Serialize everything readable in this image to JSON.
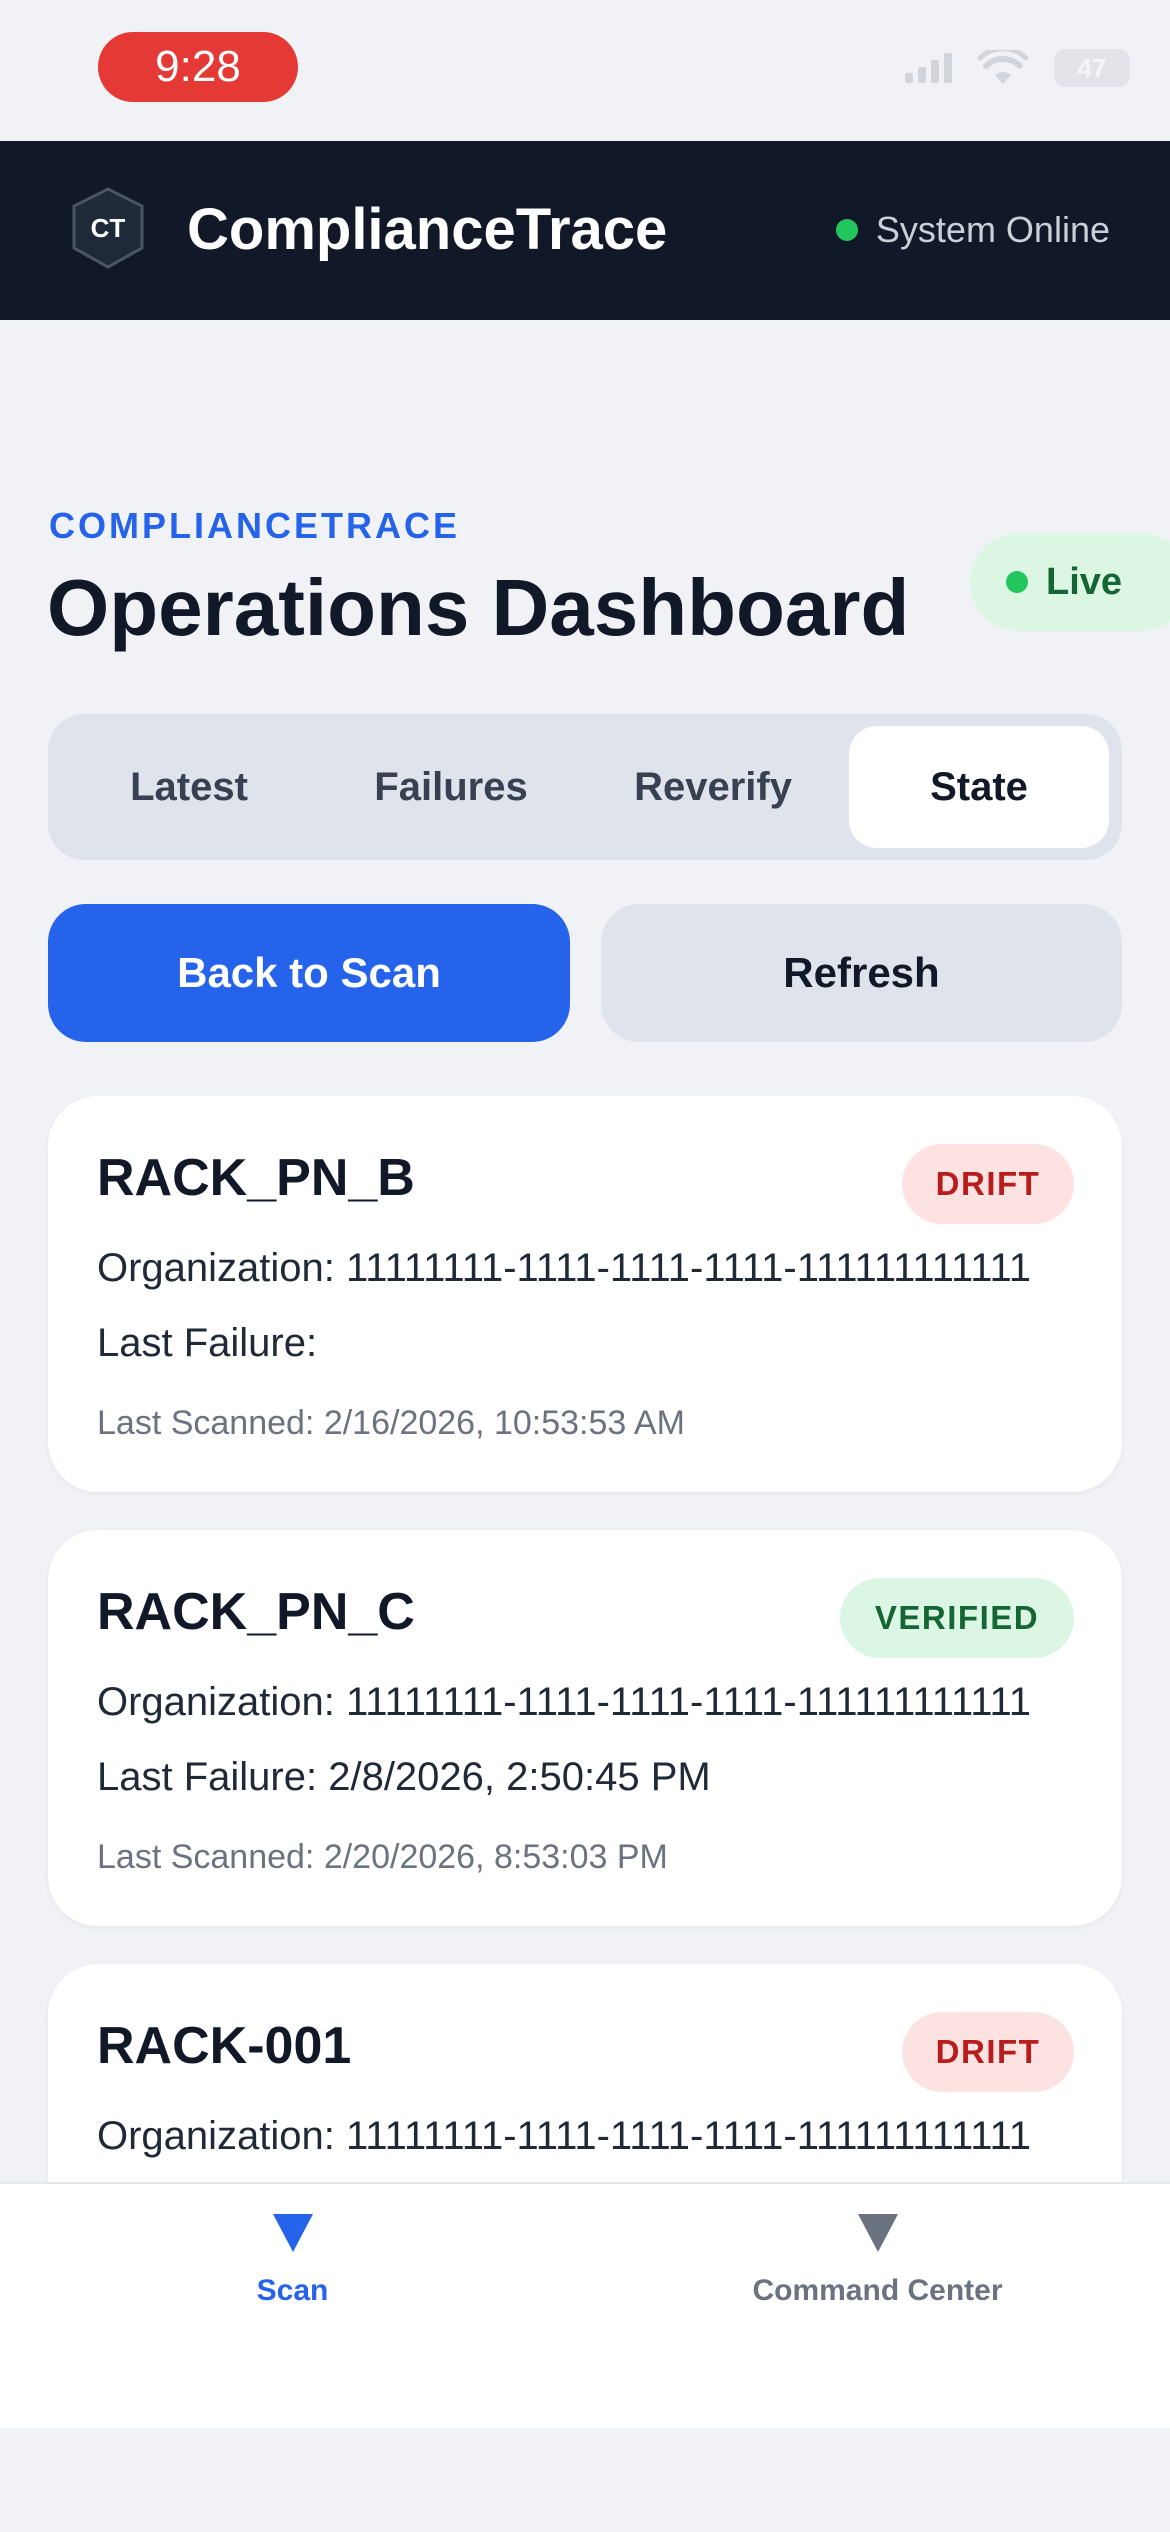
{
  "status_bar": {
    "time": "9:28",
    "battery": "47"
  },
  "header": {
    "logo_text": "CT",
    "app_name": "ComplianceTrace",
    "system_status": "System Online"
  },
  "page": {
    "eyebrow": "COMPLIANCETRACE",
    "title": "Operations Dashboard",
    "live_label": "Live"
  },
  "tabs": [
    {
      "label": "Latest",
      "active": false
    },
    {
      "label": "Failures",
      "active": false
    },
    {
      "label": "Reverify",
      "active": false
    },
    {
      "label": "State",
      "active": true
    }
  ],
  "actions": {
    "primary_label": "Back to Scan",
    "secondary_label": "Refresh"
  },
  "cards": [
    {
      "title": "RACK_PN_B",
      "status": "DRIFT",
      "organization": "Organization: 11111111-1111-1111-1111-111111111111",
      "last_failure": "Last Failure:",
      "last_scanned": "Last Scanned: 2/16/2026, 10:53:53 AM"
    },
    {
      "title": "RACK_PN_C",
      "status": "VERIFIED",
      "organization": "Organization: 11111111-1111-1111-1111-111111111111",
      "last_failure": "Last Failure: 2/8/2026, 2:50:45 PM",
      "last_scanned": "Last Scanned: 2/20/2026, 8:53:03 PM"
    },
    {
      "title": "RACK-001",
      "status": "DRIFT",
      "organization": "Organization: 11111111-1111-1111-1111-111111111111"
    }
  ],
  "bottom_nav": [
    {
      "label": "Scan",
      "icon": "triangle-down-icon",
      "active": true
    },
    {
      "label": "Command Center",
      "icon": "triangle-down-icon",
      "active": false
    }
  ],
  "colors": {
    "accent": "#2563eb",
    "header_bg": "#111827",
    "drift": "#b91c1c",
    "verified": "#166534",
    "online": "#22c55e",
    "time_pill": "#e53935"
  }
}
